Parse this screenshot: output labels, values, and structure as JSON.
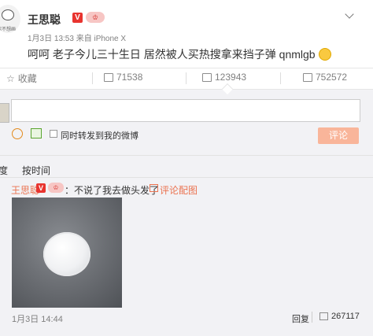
{
  "post": {
    "username": "王思聪",
    "verified_mark": "V",
    "level_badge": "♔",
    "avatar_caption": "我不想画",
    "meta": "1月3日 13:53 来自 iPhone X",
    "content": "呵呵 老子今儿三十生日 居然被人买热搜拿来挡子弹 qnmlgb"
  },
  "actions": {
    "favorite_label": "收藏",
    "repost_count": "71538",
    "comment_count": "123943",
    "like_count": "752572"
  },
  "composer": {
    "input_value": "",
    "sync_label": "同时转发到我的微博",
    "submit_label": "评论"
  },
  "tabs": {
    "left_partial": "度",
    "by_time": "按时间"
  },
  "comment": {
    "username": "王思聪",
    "verified_mark": "V",
    "level_badge": "♔",
    "text": "：不说了我去做头发了",
    "pic_link": "评论配图",
    "date": "1月3日 14:44",
    "reply_label": "回复",
    "like_count": "267117"
  },
  "colors": {
    "accent_orange": "#eb7350",
    "submit_bg": "#f9b59a",
    "verified_red": "#e8342f"
  }
}
